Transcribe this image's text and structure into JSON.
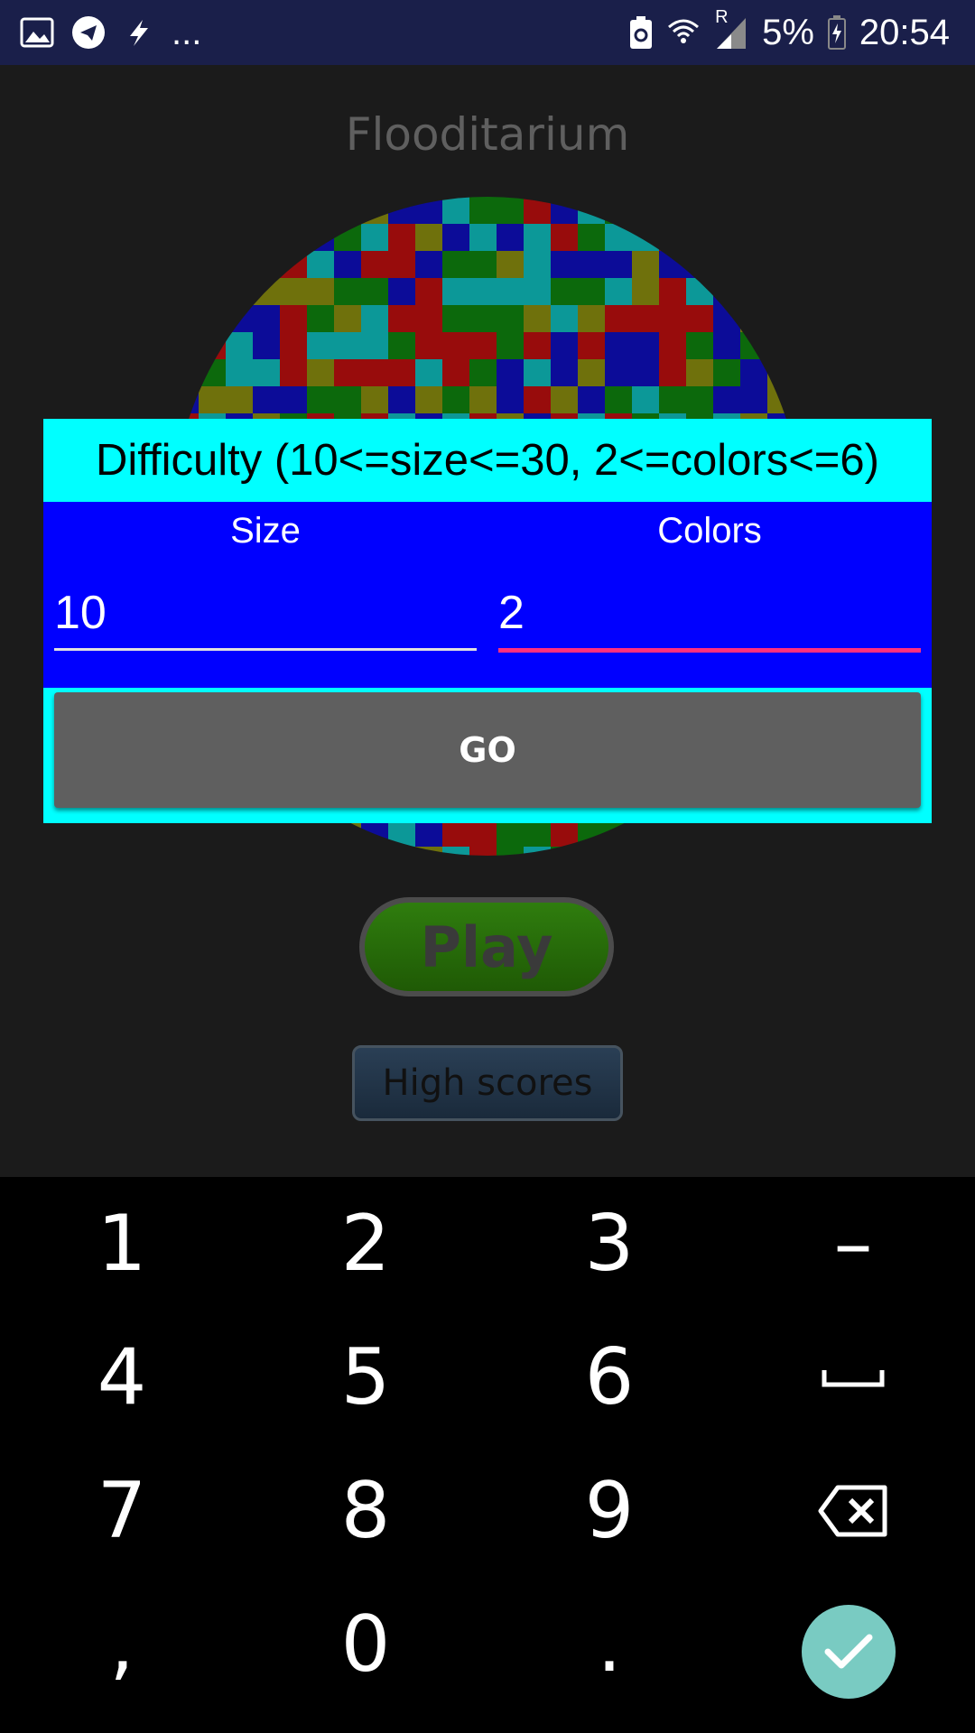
{
  "status_bar": {
    "left_icons": [
      "image-icon",
      "telegram-icon",
      "flash-icon"
    ],
    "more": "...",
    "right_icons": [
      "battery-saver-icon",
      "wifi-icon",
      "signal-icon"
    ],
    "roaming": "R",
    "battery_pct": "5%",
    "time": "20:54",
    "background": "#1a1f4a"
  },
  "app": {
    "title": "Flooditarium",
    "play_label": "Play",
    "high_scores_label": "High scores",
    "board_colors": [
      "#ff0000",
      "#00ffff",
      "#0000ff",
      "#00aa00",
      "#b5b800"
    ]
  },
  "dialog": {
    "title": "Difficulty (10<=size<=30, 2<=colors<=6)",
    "size_label": "Size",
    "size_value": "10",
    "colors_label": "Colors",
    "colors_value": "2",
    "go_label": "GO",
    "title_bg": "#00ffff",
    "body_bg": "#0000ff",
    "active_underline": "#ff2f7f"
  },
  "keyboard": {
    "rows": [
      [
        "1",
        "2",
        "3",
        "–"
      ],
      [
        "4",
        "5",
        "6",
        "space-icon"
      ],
      [
        "7",
        "8",
        "9",
        "backspace-icon"
      ],
      [
        ",",
        "0",
        ".",
        "enter-icon"
      ]
    ],
    "labels": {
      "k1": "1",
      "k2": "2",
      "k3": "3",
      "minus": "–",
      "k4": "4",
      "k5": "5",
      "k6": "6",
      "k7": "7",
      "k8": "8",
      "k9": "9",
      "comma": ",",
      "k0": "0",
      "period": "."
    },
    "enter_color": "#79cbc2"
  }
}
